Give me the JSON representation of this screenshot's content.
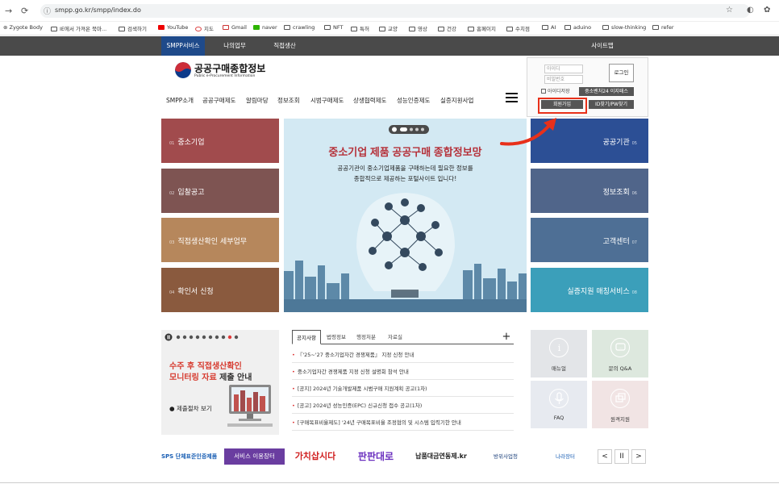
{
  "browser": {
    "url": "smpp.go.kr/smpp/index.do",
    "bookmarks": [
      "Zygote Body",
      "IE에서 가져온 북마...",
      "검색하기",
      "YouTube",
      "지도",
      "Gmail",
      "naver",
      "crawling",
      "NFT",
      "특허",
      "교양",
      "영상",
      "건강",
      "홈페이지",
      "수치점",
      "AI",
      "aduino",
      "slow-thinking",
      "refer"
    ]
  },
  "topbar": {
    "tabs": [
      "SMPP서비스",
      "나의업무",
      "직접생산"
    ],
    "sitemap": "사이트맵"
  },
  "header": {
    "logo_title": "공공구매종합정보",
    "logo_sub": "Public e-Procurement Information",
    "menu": [
      "SMPP소개",
      "공공구매제도",
      "알림마당",
      "정보조회",
      "시범구매제도",
      "상생협력제도",
      "성능인증제도",
      "실증지원사업"
    ]
  },
  "login": {
    "id_placeholder": "아이디",
    "pw_placeholder": "비밀번호",
    "login_label": "로그인",
    "remember_label": "아이디저장",
    "cert_label": "중소벤처24 이지패스",
    "join_label": "회원가입",
    "find_label": "ID찾기/PW찾기"
  },
  "left_tiles": [
    {
      "num": "01",
      "label": "중소기업",
      "color": "#a14b4d"
    },
    {
      "num": "02",
      "label": "입찰공고",
      "color": "#7e5452"
    },
    {
      "num": "03",
      "label": "직접생산확인 세부업무",
      "color": "#b6875c"
    },
    {
      "num": "04",
      "label": "확인서 신청",
      "color": "#8a5a3e"
    }
  ],
  "right_tiles": [
    {
      "num": "05",
      "label": "공공기관",
      "color": "#2c4f95"
    },
    {
      "num": "06",
      "label": "정보조회",
      "color": "#50658a"
    },
    {
      "num": "07",
      "label": "고객센터",
      "color": "#4e6f95"
    },
    {
      "num": "08",
      "label": "실증지원 매칭서비스",
      "color": "#3b9fba"
    }
  ],
  "banner": {
    "title": "중소기업 제품 공공구매 종합정보망",
    "desc1": "공공기관이 중소기업제품을 구매하는데 필요한 정보를",
    "desc2": "종합적으로 제공하는 포털사이트 입니다!"
  },
  "promo": {
    "line1": "수주 후 직접생산확인",
    "line2a": "모니터링 자료",
    "line2b": " 제출 안내",
    "link": "제출절차 보기"
  },
  "news": {
    "tabs": [
      "공지사항",
      "법령정보",
      "행정처분",
      "자료실"
    ],
    "plus": "+",
    "items": [
      "『'25~'27 중소기업자간 경쟁제품』 지정 신청 안내",
      "중소기업자간 경쟁제품 지정 신청 설명회 참석 안내",
      "[공지] 2024년 기술개발제품 시범구매 지원계획 공고(1차)",
      "[공고] 2024년 성능인증(EPC) 신규신청 접수 공고(1차)",
      "[구매목표비율제도] '24년 구매목표비율 조정협의 및 시스템 입력기한 안내"
    ]
  },
  "quick": [
    {
      "label": "매뉴얼",
      "color": "#e3e5e8"
    },
    {
      "label": "문의 Q&A",
      "color": "#dde8de"
    },
    {
      "label": "FAQ",
      "color": "#e7eaf0"
    },
    {
      "label": "원격지원",
      "color": "#f1e4e4"
    }
  ],
  "strip": {
    "items": [
      "SPS 단체표준인증제품",
      "서비스 이용장터",
      "가치삽시다",
      "판판대로",
      "납품대금연동제.kr",
      "방위사업청",
      "나라장터"
    ],
    "nav": [
      "<",
      "II",
      ">"
    ]
  }
}
